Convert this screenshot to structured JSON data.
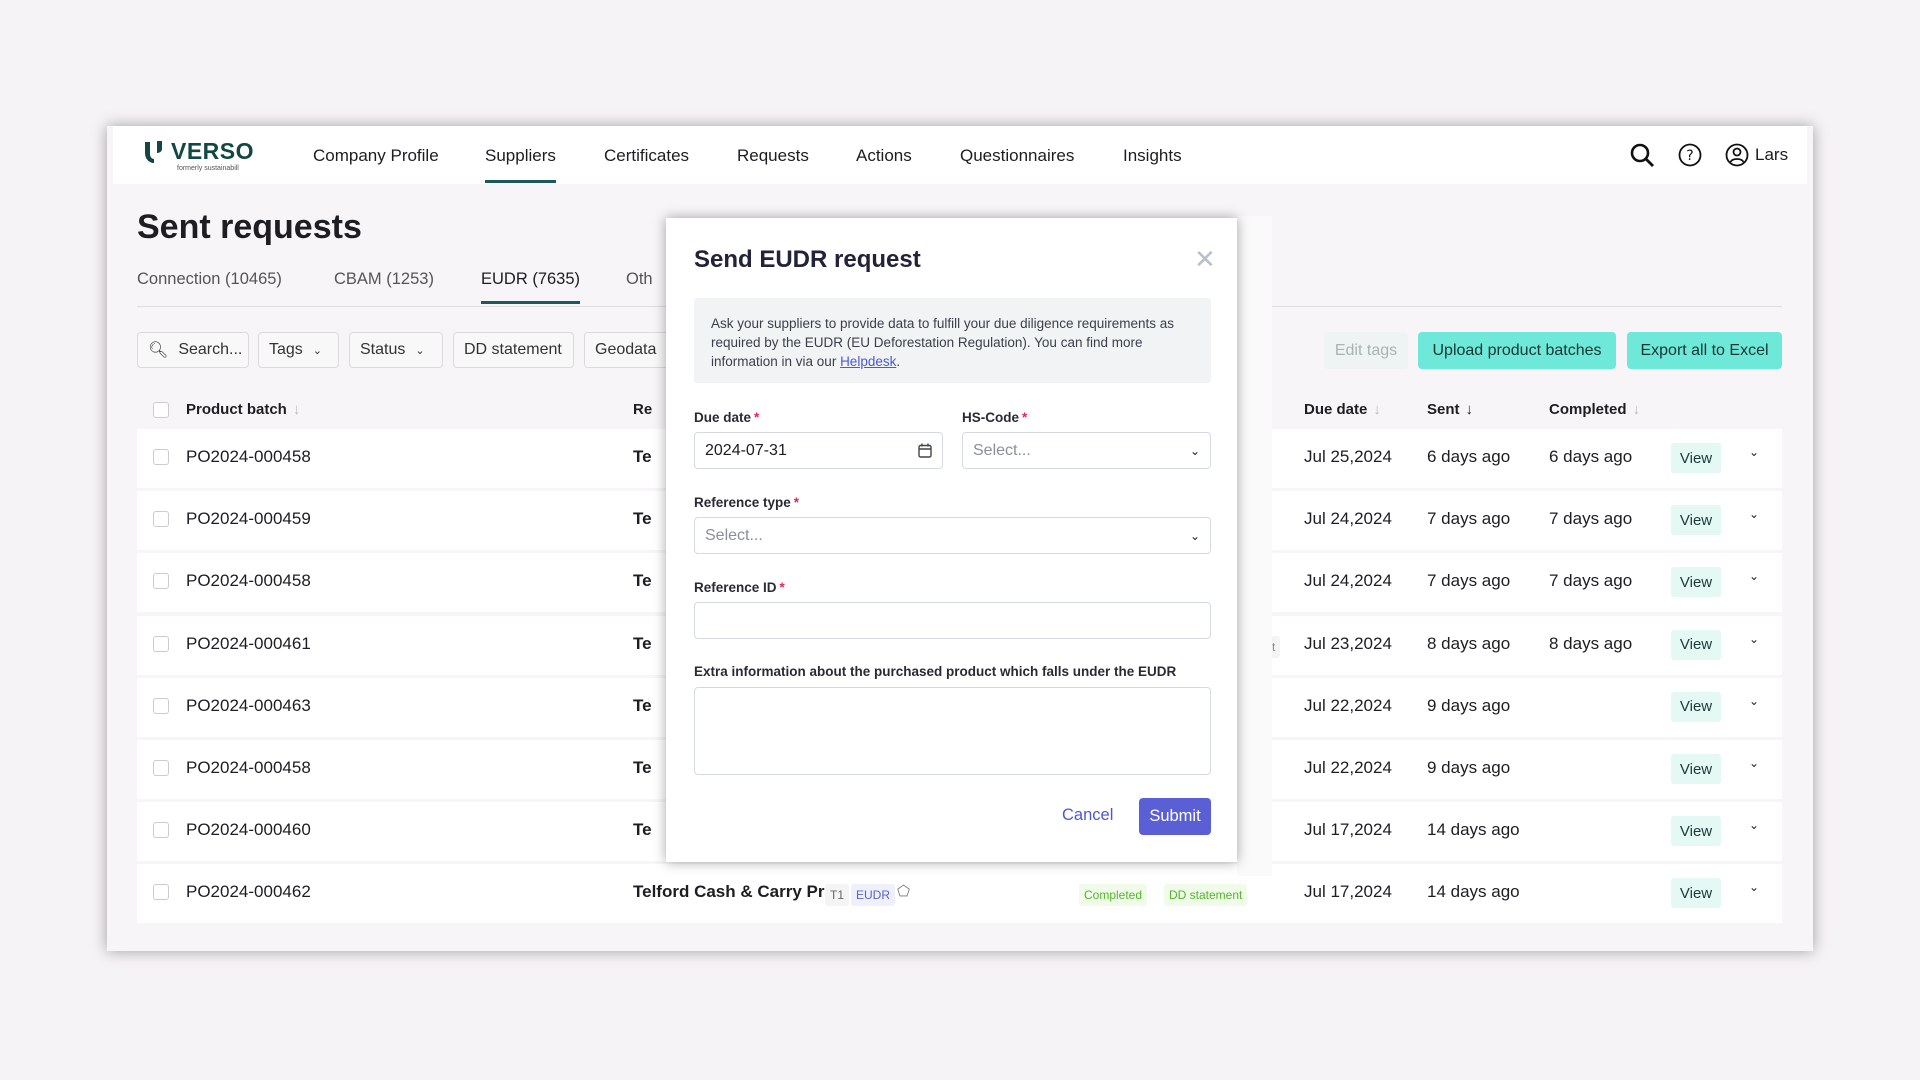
{
  "brand": {
    "name": "VERSO",
    "tagline": "formerly sustainabill",
    "color": "#124744"
  },
  "nav": {
    "items": [
      "Company Profile",
      "Suppliers",
      "Certificates",
      "Requests",
      "Actions",
      "Questionnaires",
      "Insights"
    ],
    "active": "Suppliers",
    "user": "Lars"
  },
  "page": {
    "title": "Sent requests"
  },
  "tabs": [
    "Connection (10465)",
    "CBAM (1253)",
    "EUDR (7635)",
    "Oth"
  ],
  "filters": {
    "search_placeholder": "Search...",
    "tags": "Tags",
    "status": "Status",
    "dd_statement": "DD statement",
    "geodata": "Geodata"
  },
  "actions": {
    "edit_tags": "Edit tags",
    "upload": "Upload product batches",
    "export": "Export all to Excel",
    "accent": "#6ee8d8"
  },
  "table": {
    "headers": {
      "product_batch": "Product batch",
      "requester": "Re",
      "due_date": "Due date",
      "sent": "Sent",
      "completed": "Completed"
    },
    "view_label": "View",
    "rows": [
      {
        "batch": "PO2024-000458",
        "req": "Te",
        "due": "Jul 25,2024",
        "sent": "6 days ago",
        "completed": "6 days ago"
      },
      {
        "batch": "PO2024-000459",
        "req": "Te",
        "due": "Jul 24,2024",
        "sent": "7 days ago",
        "completed": "7 days ago"
      },
      {
        "batch": "PO2024-000458",
        "req": "Te",
        "due": "Jul 24,2024",
        "sent": "7 days ago",
        "completed": "7 days ago"
      },
      {
        "batch": "PO2024-000461",
        "req": "Te",
        "due": "Jul 23,2024",
        "sent": "8 days ago",
        "completed": "8 days ago",
        "extra": "t"
      },
      {
        "batch": "PO2024-000463",
        "req": "Te",
        "due": "Jul 22,2024",
        "sent": "9 days ago",
        "completed": ""
      },
      {
        "batch": "PO2024-000458",
        "req": "Te",
        "due": "Jul 22,2024",
        "sent": "9 days ago",
        "completed": ""
      },
      {
        "batch": "PO2024-000460",
        "req": "Te",
        "due": "Jul 17,2024",
        "sent": "14 days ago",
        "completed": ""
      },
      {
        "batch": "PO2024-000462",
        "req": "Telford Cash & Carry Pro",
        "tier": "T1",
        "type": "EUDR",
        "status": "Completed",
        "dd": "DD statement",
        "due": "Jul 17,2024",
        "sent": "14 days ago",
        "completed": ""
      }
    ]
  },
  "modal": {
    "title": "Send EUDR request",
    "info_text": "Ask your suppliers to provide data to fulfill your due diligence requirements as required by the EUDR (EU Deforestation Regulation). You can find more information in via our ",
    "helpdesk": "Helpdesk",
    "info_end": ".",
    "due_date_label": "Due date",
    "due_date_value": "2024-07-31",
    "hs_code_label": "HS-Code",
    "hs_code_placeholder": "Select...",
    "ref_type_label": "Reference type",
    "ref_type_placeholder": "Select...",
    "ref_id_label": "Reference ID",
    "ref_id_value": "",
    "extra_label": "Extra information about the purchased product which falls under the EUDR",
    "extra_value": "",
    "required_mark": "*",
    "cancel": "Cancel",
    "submit": "Submit",
    "submit_color": "#5a5fd6"
  }
}
